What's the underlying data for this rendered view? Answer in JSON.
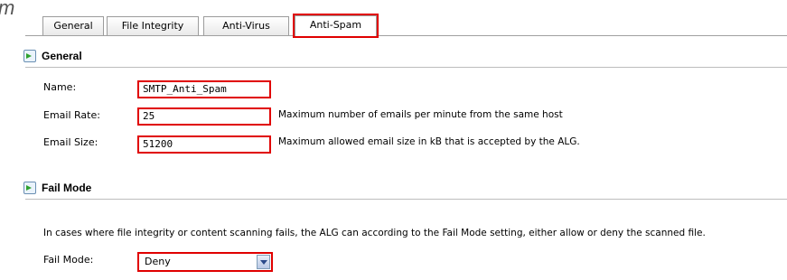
{
  "partial_heading": "m",
  "tabs": [
    {
      "label": "General"
    },
    {
      "label": "File Integrity"
    },
    {
      "label": "Anti-Virus"
    },
    {
      "label": "Anti-Spam"
    }
  ],
  "active_tab": "Anti-Spam",
  "general": {
    "title": "General",
    "name_label": "Name:",
    "name_value": "SMTP_Anti_Spam",
    "rate_label": "Email Rate:",
    "rate_value": "25",
    "rate_desc": "Maximum number of emails per minute from the same host",
    "size_label": "Email Size:",
    "size_value": "51200",
    "size_desc": "Maximum allowed email size in kB that is accepted by the ALG."
  },
  "fail_mode": {
    "title": "Fail Mode",
    "description": "In cases where file integrity or content scanning fails, the ALG can according to the Fail Mode setting, either allow or deny the scanned file.",
    "label": "Fail Mode:",
    "value": "Deny"
  },
  "colors": {
    "highlight": "#e00000",
    "section_icon": "#2ea12e"
  }
}
